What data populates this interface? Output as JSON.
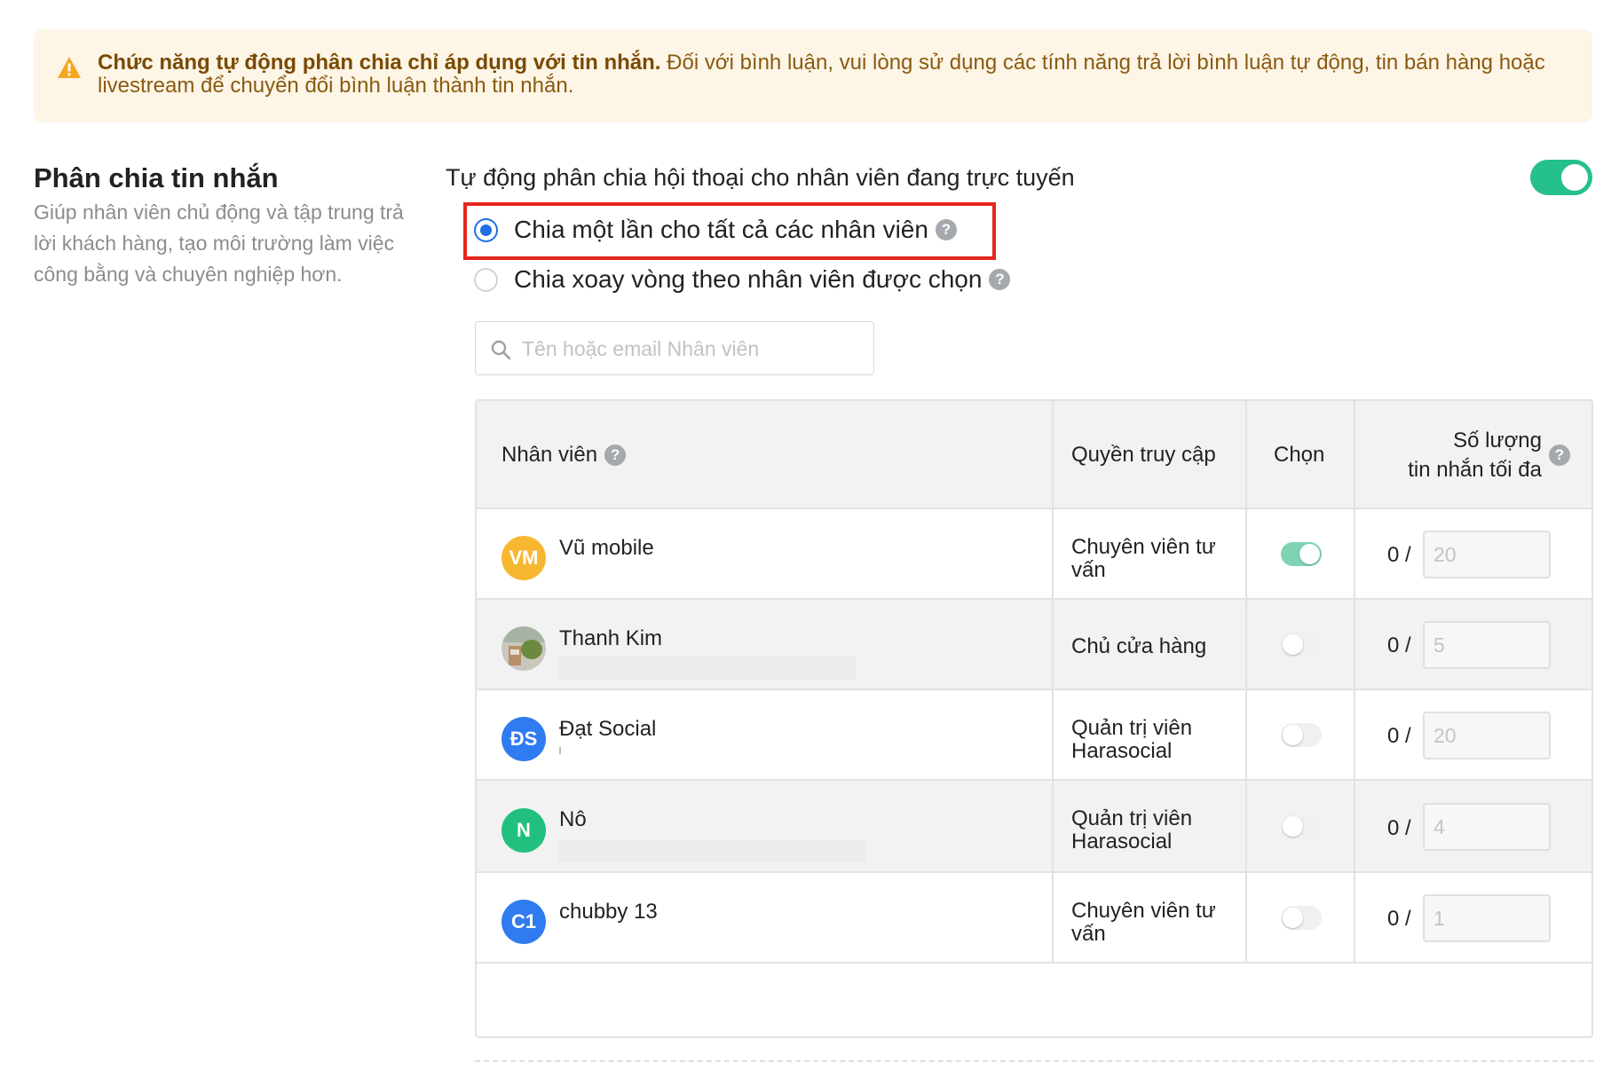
{
  "banner": {
    "bold_text": "Chức năng tự động phân chia chỉ áp dụng với tin nhắn.",
    "text": " Đối với bình luận, vui lòng sử dụng các tính năng trả lời bình luận tự động, tin bán hàng hoặc livestream để chuyển đổi bình luận thành tin nhắn.",
    "icon": "warning-icon",
    "color": "#f5a623"
  },
  "section": {
    "title": "Phân chia tin nhắn",
    "description": "Giúp nhân viên chủ động và tập trung trả lời khách hàng, tạo môi trường làm việc công bằng và chuyên nghiệp hơn."
  },
  "auto_assign": {
    "label": "Tự động phân chia hội thoại cho nhân viên đang trực tuyến",
    "enabled": true,
    "accent": "#26c08a"
  },
  "modes": [
    {
      "label": "Chia một lần cho tất cả các nhân viên",
      "selected": true
    },
    {
      "label": "Chia xoay vòng theo nhân viên được chọn",
      "selected": false
    }
  ],
  "search": {
    "placeholder": "Tên hoặc email Nhân viên",
    "value": ""
  },
  "table": {
    "headers": {
      "employee": "Nhân viên",
      "access": "Quyền truy cập",
      "select": "Chọn",
      "max_line1": "Số lượng",
      "max_line2": "tin nhắn tối đa"
    },
    "rows": [
      {
        "initials": "VM",
        "avatar_color": "#f7b731",
        "name": "Vũ mobile",
        "role": "Chuyên viên tư vấn",
        "selected": true,
        "count": "0 /",
        "max": "20"
      },
      {
        "initials": "",
        "avatar_color": "photo",
        "name": "Thanh Kim",
        "role": "Chủ cửa hàng",
        "selected": false,
        "count": "0 /",
        "max": "5"
      },
      {
        "initials": "ĐS",
        "avatar_color": "#2f7bf0",
        "name": "Đạt Social",
        "role": "Quản trị viên Harasocial",
        "selected": false,
        "count": "0 /",
        "max": "20"
      },
      {
        "initials": "N",
        "avatar_color": "#21c07f",
        "name": "Nô",
        "role": "Quản trị viên Harasocial",
        "selected": false,
        "count": "0 /",
        "max": "4"
      },
      {
        "initials": "C1",
        "avatar_color": "#2f7bf0",
        "name": "chubby 13",
        "role": "Chuyên viên tư vấn",
        "selected": false,
        "count": "0 /",
        "max": "1"
      }
    ]
  }
}
